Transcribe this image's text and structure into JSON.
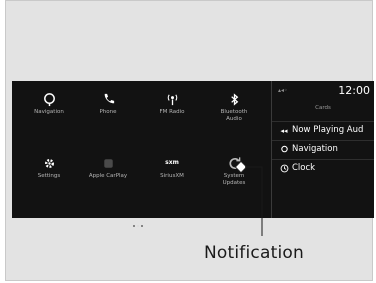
{
  "apps": [
    {
      "label": "Navigation",
      "icon": "navigation-icon"
    },
    {
      "label": "Phone",
      "icon": "phone-icon"
    },
    {
      "label": "FM Radio",
      "icon": "radio-icon"
    },
    {
      "label": "Bluetooth\nAudio",
      "icon": "bluetooth-icon"
    },
    {
      "label": "Settings",
      "icon": "gear-icon"
    },
    {
      "label": "Apple CarPlay",
      "icon": "carplay-icon"
    },
    {
      "label": "SiriusXM",
      "icon": "siriusxm-icon"
    },
    {
      "label": "System\nUpdates",
      "icon": "system-updates-icon"
    }
  ],
  "siriusxm_logo": "sxm",
  "status": {
    "time": "12:00"
  },
  "cards": {
    "title": "Cards",
    "items": [
      {
        "label": "Now Playing Aud",
        "icon": "audio-icon"
      },
      {
        "label": "Navigation",
        "icon": "navigation-icon"
      },
      {
        "label": "Clock",
        "icon": "clock-icon"
      }
    ]
  },
  "callout": {
    "label": "Notification"
  }
}
